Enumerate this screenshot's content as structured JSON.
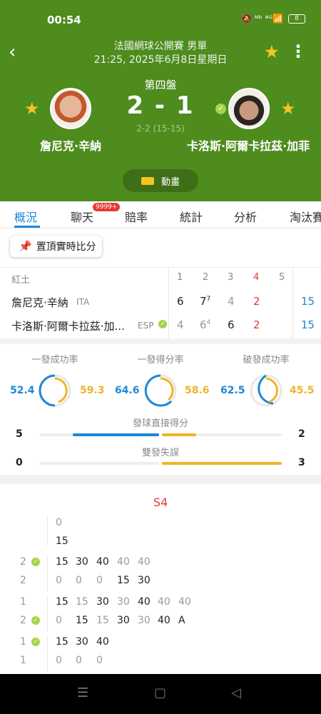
{
  "status": {
    "time": "00:54",
    "icons": "🔕 ᴺᵇ ⁴ᴳ📶",
    "battery": "8"
  },
  "header": {
    "tournament": "法國網球公開賽 男單",
    "datetime": "21:25, 2025年6月8日星期日",
    "set_label": "第四盤",
    "score": "2 - 1",
    "game_score": "2-2 (15-15)",
    "player1": "詹尼克·辛納",
    "player2": "卡洛斯·阿爾卡拉茲·加菲",
    "animation_label": "動畫"
  },
  "tabs": [
    "概況",
    "聊天",
    "賠率",
    "統計",
    "分析",
    "淘汰賽"
  ],
  "chat_badge": "9999+",
  "pin_label": "置頂實時比分",
  "sets_table": {
    "surface": "紅土",
    "set_numbers": [
      "1",
      "2",
      "3",
      "4",
      "5"
    ],
    "rows": [
      {
        "name": "詹尼克·辛納",
        "nat": "ITA",
        "s1": "6",
        "s2": "7",
        "s2_tb": "7",
        "s3": "4",
        "s4": "2",
        "total": "15"
      },
      {
        "name": "卡洛斯·阿爾卡拉茲·加...",
        "nat": "ESP",
        "s1": "4",
        "s2": "6",
        "s2_tb": "4",
        "s3": "6",
        "s4": "2",
        "total": "15"
      }
    ]
  },
  "stats": {
    "rings": [
      {
        "title": "一發成功率",
        "p1": "52.4",
        "p2": "59.3"
      },
      {
        "title": "一發得分率",
        "p1": "64.6",
        "p2": "58.6"
      },
      {
        "title": "破發成功率",
        "p1": "62.5",
        "p2": "45.5"
      }
    ],
    "bars": [
      {
        "title": "發球直接得分",
        "p1": "5",
        "p2": "2"
      },
      {
        "title": "雙發失誤",
        "p1": "0",
        "p2": "3"
      }
    ]
  },
  "points": {
    "set_label": "S4",
    "games": [
      {
        "left": [
          "",
          ""
        ],
        "top": [
          "0"
        ],
        "bottom": [
          "15"
        ]
      },
      {
        "left": [
          "2",
          "2"
        ],
        "top": [
          "15",
          "30",
          "40",
          "40",
          "40"
        ],
        "bottom": [
          "0",
          "0",
          "0",
          "15",
          "30"
        ]
      },
      {
        "left": [
          "1",
          "2"
        ],
        "top": [
          "15",
          "15",
          "30",
          "30",
          "40",
          "40",
          "40"
        ],
        "bottom": [
          "0",
          "15",
          "15",
          "30",
          "30",
          "40",
          "A"
        ]
      },
      {
        "left": [
          "1",
          "1"
        ],
        "top": [
          "15",
          "30",
          "40"
        ],
        "bottom": [
          "0",
          "0",
          "0"
        ]
      }
    ]
  },
  "colors": {
    "green": "#4e8c1e",
    "blue": "#1e88d6",
    "orange": "#f0b429",
    "red": "#e53935"
  }
}
